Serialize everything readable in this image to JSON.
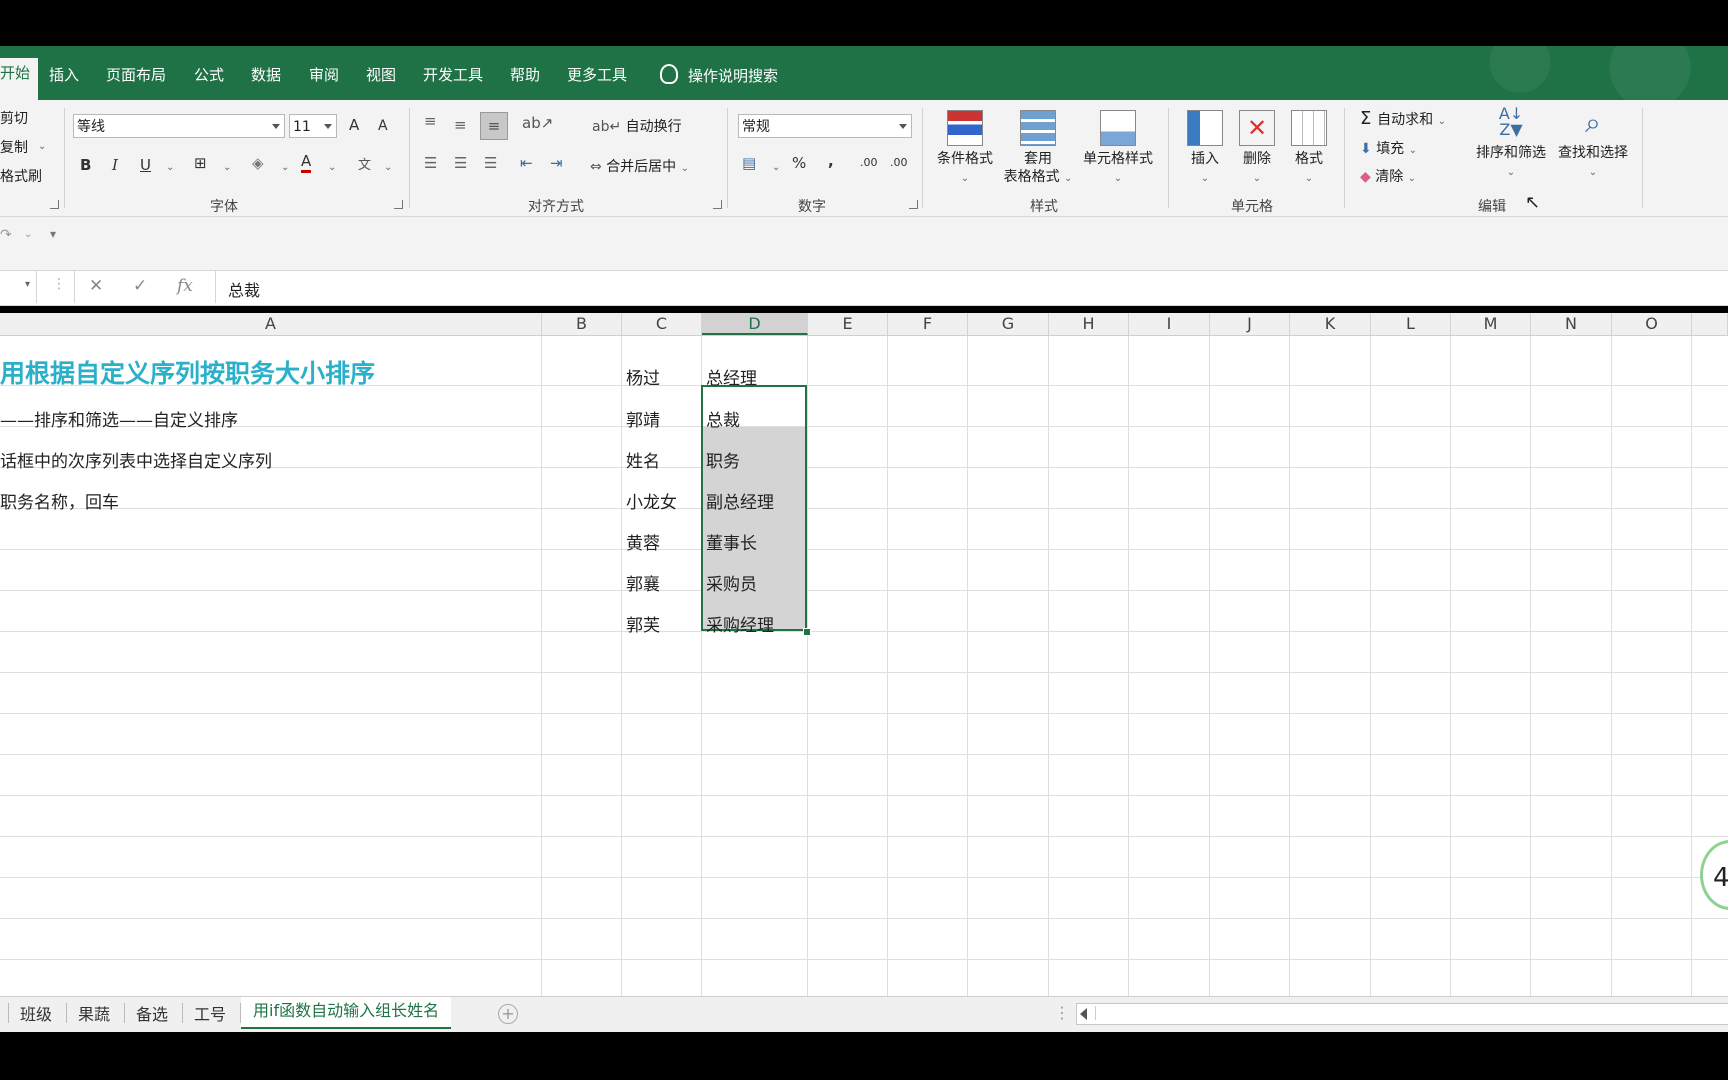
{
  "tabs": {
    "home": "开始",
    "insert": "插入",
    "page_layout": "页面布局",
    "formulas": "公式",
    "data": "数据",
    "review": "审阅",
    "view": "视图",
    "developer": "开发工具",
    "help": "帮助",
    "more_tools": "更多工具",
    "tell_me": "操作说明搜索"
  },
  "clipboard": {
    "cut": "剪切",
    "copy": "复制",
    "format_painter": "格式刷"
  },
  "font": {
    "group_label": "字体",
    "name": "等线",
    "size": "11",
    "grow": "A",
    "shrink": "A",
    "bold": "B",
    "italic": "I",
    "underline": "U",
    "font_color": "A",
    "phonetic": "文"
  },
  "alignment": {
    "group_label": "对齐方式",
    "wrap_text": "自动换行",
    "merge_center": "合并后居中"
  },
  "number": {
    "group_label": "数字",
    "format": "常规",
    "percent": "%",
    "comma": ",",
    "inc_decimal": ".00",
    "dec_decimal": ".00"
  },
  "styles": {
    "group_label": "样式",
    "conditional": "条件格式",
    "table_format_1": "套用",
    "table_format_2": "表格格式",
    "cell_styles": "单元格样式"
  },
  "cells": {
    "group_label": "单元格",
    "insert": "插入",
    "delete": "删除",
    "format": "格式"
  },
  "editing": {
    "group_label": "编辑",
    "autosum": "自动求和",
    "fill": "填充",
    "clear": "清除",
    "sort_filter": "排序和筛选",
    "find_select": "查找和选择"
  },
  "formula_bar": {
    "fx": "fx",
    "value": "总裁"
  },
  "columns": [
    "A",
    "B",
    "C",
    "D",
    "E",
    "F",
    "G",
    "H",
    "I",
    "J",
    "K",
    "L",
    "M",
    "N",
    "O"
  ],
  "cells_content": {
    "a1": "用根据自定义序列按职务大小排序",
    "a2": "——排序和筛选——自定义排序",
    "a3": "话框中的次序列表中选择自定义序列",
    "a4": "职务名称，回车",
    "c": [
      "杨过",
      "郭靖",
      "姓名",
      "小龙女",
      "黄蓉",
      "郭襄",
      "郭芙"
    ],
    "d": [
      "总经理",
      "总裁",
      "职务",
      "副总经理",
      "董事长",
      "采购员",
      "采购经理"
    ]
  },
  "side_badge": "4",
  "sheet_tabs": [
    "班级",
    "果蔬",
    "备选",
    "工号",
    "用if函数自动输入组长姓名"
  ],
  "colors": {
    "accent": "#217346",
    "ribbon_tab_bg": "#1f7246",
    "title_text": "#2ab0c9"
  }
}
